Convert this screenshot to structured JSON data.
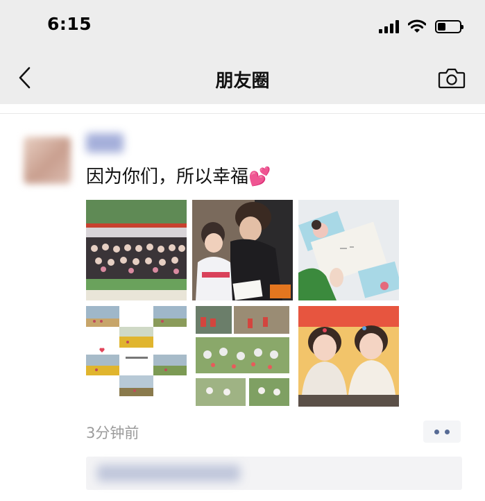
{
  "status_bar": {
    "time": "6:15",
    "signal_bars": 4,
    "battery_level": 0.35
  },
  "nav": {
    "back_icon": "chevron-left-icon",
    "title": "朋友圈",
    "camera_icon": "camera-icon"
  },
  "post": {
    "text": "因为你们，所以幸福💕",
    "photos": [
      "group-photo-banner",
      "mother-and-child-reading-card",
      "envelope-with-cards",
      "collage-outdoor-field",
      "collage-picnic-kids",
      "two-girls-smiling-classroom"
    ],
    "time_ago": "3分钟前",
    "more_icon": "more-dots-icon"
  },
  "colors": {
    "header_bg": "#ededed",
    "link_blue": "#576b95",
    "meta_gray": "#9b9b9b"
  }
}
